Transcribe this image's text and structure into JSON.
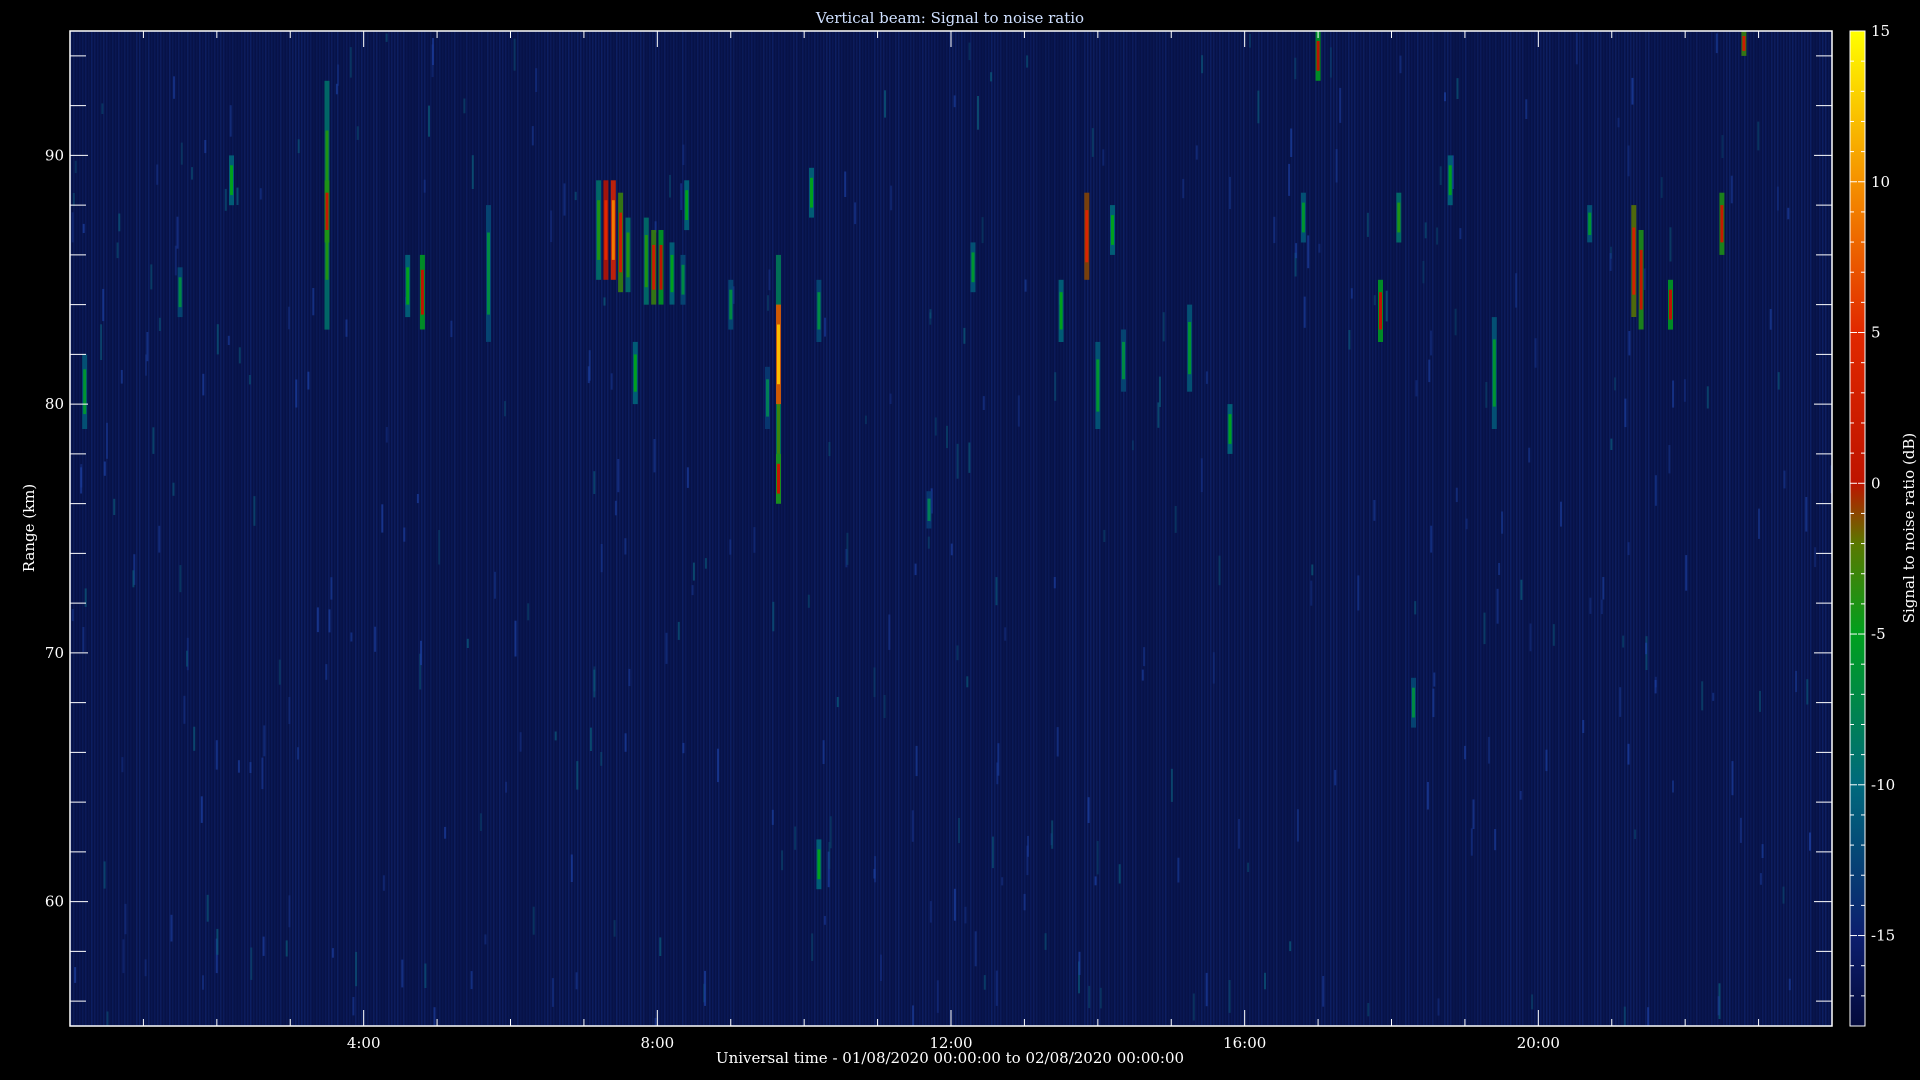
{
  "chart_data": {
    "type": "heatmap",
    "title": "Vertical beam: Signal to noise ratio",
    "xlabel": "Universal time - 01/08/2020 00:00:00 to 02/08/2020 00:00:00",
    "ylabel": "Range (km)",
    "colorbar_label": "Signal to noise ratio (dB)",
    "xlim": [
      0,
      24
    ],
    "ylim": [
      55,
      95
    ],
    "clim": [
      -18,
      15
    ],
    "x_ticks": [
      {
        "value": 4,
        "label": "4:00"
      },
      {
        "value": 8,
        "label": "8:00"
      },
      {
        "value": 12,
        "label": "12:00"
      },
      {
        "value": 16,
        "label": "16:00"
      },
      {
        "value": 20,
        "label": "20:00"
      }
    ],
    "y_ticks": [
      {
        "value": 60,
        "label": "60"
      },
      {
        "value": 70,
        "label": "70"
      },
      {
        "value": 80,
        "label": "80"
      },
      {
        "value": 90,
        "label": "90"
      }
    ],
    "colorbar_ticks": [
      {
        "value": -15,
        "label": "-15"
      },
      {
        "value": -10,
        "label": "-10"
      },
      {
        "value": -5,
        "label": "-5"
      },
      {
        "value": 0,
        "label": "0"
      },
      {
        "value": 5,
        "label": "5"
      },
      {
        "value": 10,
        "label": "10"
      },
      {
        "value": 15,
        "label": "15"
      }
    ],
    "background_snr": -17,
    "events": [
      {
        "t": 0.2,
        "r0": 79.0,
        "r1": 82.0,
        "snr": -6
      },
      {
        "t": 1.5,
        "r0": 83.5,
        "r1": 85.5,
        "snr": -7
      },
      {
        "t": 2.2,
        "r0": 88.0,
        "r1": 90.0,
        "snr": -5
      },
      {
        "t": 3.5,
        "r0": 83.0,
        "r1": 93.0,
        "snr": -4
      },
      {
        "t": 3.5,
        "r0": 86.5,
        "r1": 89.0,
        "snr": 1
      },
      {
        "t": 4.6,
        "r0": 83.5,
        "r1": 86.0,
        "snr": -5
      },
      {
        "t": 4.8,
        "r0": 83.0,
        "r1": 86.0,
        "snr": 0
      },
      {
        "t": 5.7,
        "r0": 82.5,
        "r1": 88.0,
        "snr": -7
      },
      {
        "t": 7.2,
        "r0": 85.0,
        "r1": 89.0,
        "snr": -4
      },
      {
        "t": 7.3,
        "r0": 85.0,
        "r1": 89.0,
        "snr": 5
      },
      {
        "t": 7.4,
        "r0": 85.0,
        "r1": 89.0,
        "snr": 9
      },
      {
        "t": 7.5,
        "r0": 84.5,
        "r1": 88.5,
        "snr": 2
      },
      {
        "t": 7.6,
        "r0": 84.5,
        "r1": 87.5,
        "snr": -4
      },
      {
        "t": 7.7,
        "r0": 80.0,
        "r1": 82.5,
        "snr": -5
      },
      {
        "t": 7.85,
        "r0": 84.0,
        "r1": 87.5,
        "snr": -4
      },
      {
        "t": 7.95,
        "r0": 84.0,
        "r1": 87.0,
        "snr": 2
      },
      {
        "t": 8.05,
        "r0": 84.0,
        "r1": 87.0,
        "snr": 0
      },
      {
        "t": 8.2,
        "r0": 84.0,
        "r1": 86.5,
        "snr": -5
      },
      {
        "t": 8.35,
        "r0": 84.0,
        "r1": 86.0,
        "snr": -7
      },
      {
        "t": 8.4,
        "r0": 87.0,
        "r1": 89.0,
        "snr": -5
      },
      {
        "t": 9.0,
        "r0": 83.0,
        "r1": 85.0,
        "snr": -7
      },
      {
        "t": 9.5,
        "r0": 79.0,
        "r1": 81.5,
        "snr": -8
      },
      {
        "t": 9.65,
        "r0": 76.0,
        "r1": 86.0,
        "snr": -3
      },
      {
        "t": 9.65,
        "r0": 80.0,
        "r1": 84.0,
        "snr": 12
      },
      {
        "t": 9.65,
        "r0": 76.0,
        "r1": 78.0,
        "snr": 1
      },
      {
        "t": 10.1,
        "r0": 87.5,
        "r1": 89.5,
        "snr": -5
      },
      {
        "t": 10.2,
        "r0": 82.5,
        "r1": 85.0,
        "snr": -7
      },
      {
        "t": 10.2,
        "r0": 60.5,
        "r1": 62.5,
        "snr": -5
      },
      {
        "t": 11.7,
        "r0": 75.0,
        "r1": 76.5,
        "snr": -8
      },
      {
        "t": 12.3,
        "r0": 84.5,
        "r1": 86.5,
        "snr": -6
      },
      {
        "t": 13.5,
        "r0": 82.5,
        "r1": 85.0,
        "snr": -5
      },
      {
        "t": 13.85,
        "r0": 85.0,
        "r1": 88.5,
        "snr": 4
      },
      {
        "t": 14.0,
        "r0": 79.0,
        "r1": 82.5,
        "snr": -6
      },
      {
        "t": 14.2,
        "r0": 86.0,
        "r1": 88.0,
        "snr": -5
      },
      {
        "t": 14.35,
        "r0": 80.5,
        "r1": 83.0,
        "snr": -7
      },
      {
        "t": 15.25,
        "r0": 80.5,
        "r1": 84.0,
        "snr": -6
      },
      {
        "t": 15.8,
        "r0": 78.0,
        "r1": 80.0,
        "snr": -5
      },
      {
        "t": 16.8,
        "r0": 86.5,
        "r1": 88.5,
        "snr": -6
      },
      {
        "t": 17.0,
        "r0": 93.0,
        "r1": 95.0,
        "snr": 0
      },
      {
        "t": 17.85,
        "r0": 82.5,
        "r1": 85.0,
        "snr": 0
      },
      {
        "t": 18.1,
        "r0": 86.5,
        "r1": 88.5,
        "snr": -4
      },
      {
        "t": 18.3,
        "r0": 67.0,
        "r1": 69.0,
        "snr": -7
      },
      {
        "t": 18.8,
        "r0": 88.0,
        "r1": 90.0,
        "snr": -5
      },
      {
        "t": 19.4,
        "r0": 79.0,
        "r1": 83.5,
        "snr": -6
      },
      {
        "t": 20.7,
        "r0": 86.5,
        "r1": 88.0,
        "snr": -6
      },
      {
        "t": 21.3,
        "r0": 83.5,
        "r1": 88.0,
        "snr": 3
      },
      {
        "t": 21.4,
        "r0": 83.0,
        "r1": 87.0,
        "snr": 1
      },
      {
        "t": 21.8,
        "r0": 83.0,
        "r1": 85.0,
        "snr": 0
      },
      {
        "t": 22.5,
        "r0": 86.0,
        "r1": 88.5,
        "snr": 1
      },
      {
        "t": 22.8,
        "r0": 94.0,
        "r1": 95.0,
        "snr": 2
      }
    ]
  }
}
